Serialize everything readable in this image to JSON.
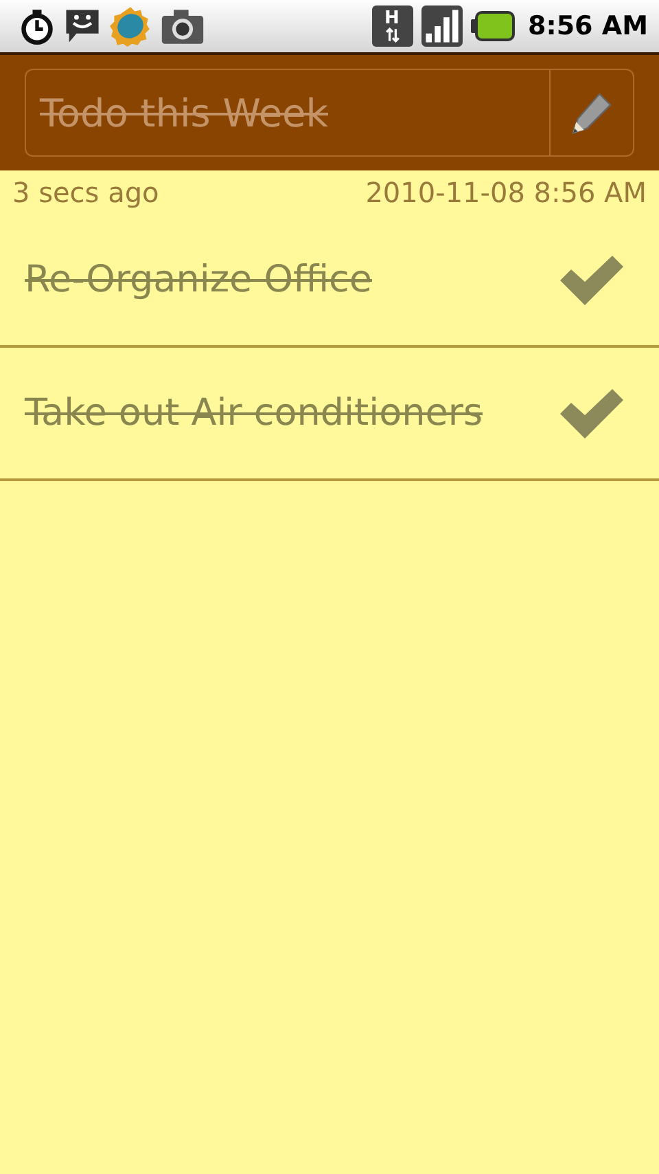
{
  "status_bar": {
    "network_type": "H",
    "time": "8:56 AM"
  },
  "header": {
    "title": "Todo this Week",
    "done": true
  },
  "meta": {
    "updated": "3 secs ago",
    "timestamp": "2010-11-08 8:56 AM"
  },
  "items": [
    {
      "text": "Re-Organize Office",
      "done": true
    },
    {
      "text": "Take out Air conditioners",
      "done": true
    }
  ]
}
